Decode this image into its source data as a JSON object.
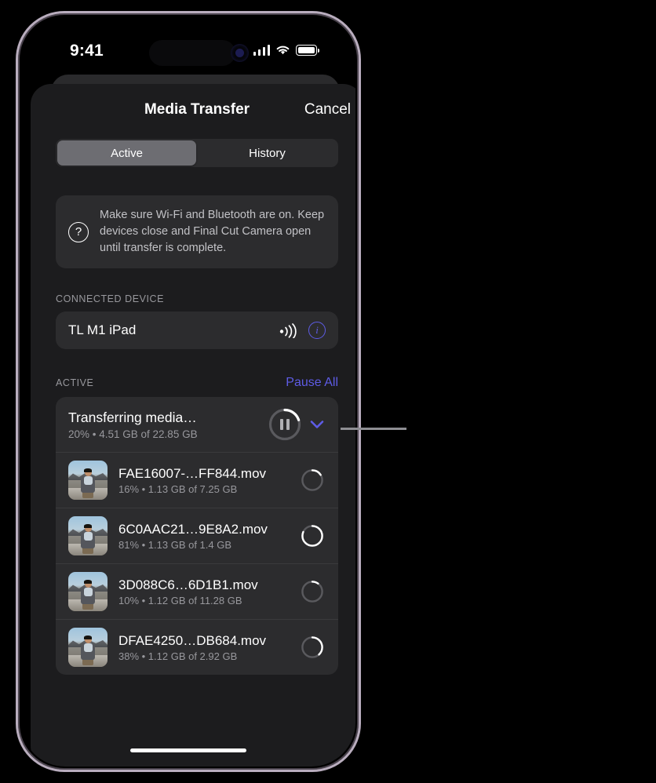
{
  "status_bar": {
    "time": "9:41",
    "cellular_icon": "cellular-bars-icon",
    "wifi_icon": "wifi-icon",
    "battery_icon": "battery-icon"
  },
  "sheet": {
    "title": "Media Transfer",
    "cancel_label": "Cancel",
    "segmented_control": {
      "selected": "Active",
      "options": [
        "Active",
        "History"
      ]
    },
    "info_banner": {
      "icon": "question-mark-circle-icon",
      "text": "Make sure Wi-Fi and Bluetooth are on. Keep devices close and Final Cut Camera open until transfer is complete."
    },
    "connected_device": {
      "section_label": "CONNECTED DEVICE",
      "name": "TL M1 iPad",
      "wireless_icon": "airdrop-wireless-icon",
      "info_icon": "info-circle-icon"
    },
    "active_section": {
      "section_label": "ACTIVE",
      "pause_all_label": "Pause All",
      "transfer": {
        "title": "Transferring media…",
        "subtitle": "20% • 4.51 GB of 22.85 GB",
        "percent": 20,
        "pause_icon": "pause-icon",
        "expand_icon": "chevron-down-icon"
      },
      "files": [
        {
          "name": "FAE16007-…FF844.mov",
          "subtitle": "16% • 1.13 GB of 7.25 GB",
          "percent": 16,
          "thumbnail": "person-on-rocks-thumbnail"
        },
        {
          "name": "6C0AAC21…9E8A2.mov",
          "subtitle": "81% • 1.13 GB of 1.4 GB",
          "percent": 81,
          "thumbnail": "person-on-rocks-thumbnail"
        },
        {
          "name": "3D088C6…6D1B1.mov",
          "subtitle": "10% • 1.12 GB of 11.28 GB",
          "percent": 10,
          "thumbnail": "person-on-rocks-thumbnail"
        },
        {
          "name": "DFAE4250…DB684.mov",
          "subtitle": "38% • 1.12 GB of 2.92 GB",
          "percent": 38,
          "thumbnail": "person-on-rocks-thumbnail"
        }
      ]
    }
  },
  "colors": {
    "accent": "#5e5ce6",
    "sheet_background": "#1c1c1e",
    "card_background": "#2c2c2e",
    "secondary_text": "#98989d",
    "selected_segment": "#6d6d72",
    "callout_line": "#8e8e93"
  }
}
